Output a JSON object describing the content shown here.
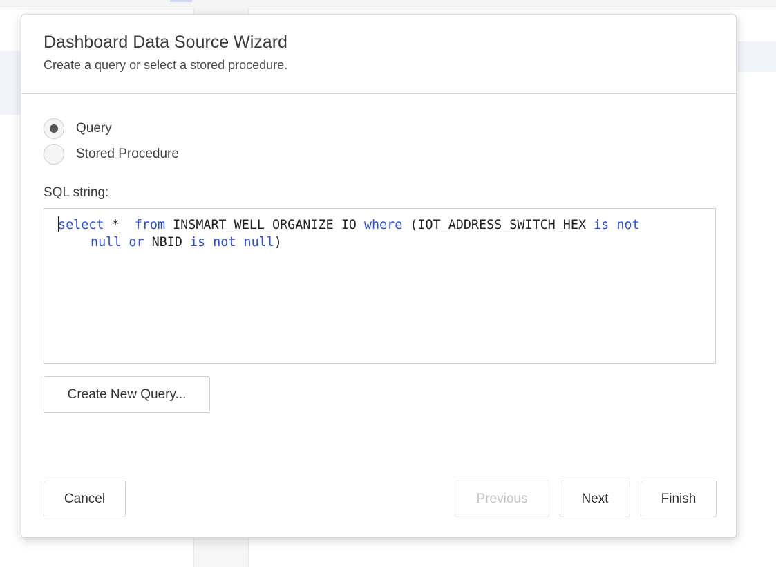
{
  "dialog": {
    "title": "Dashboard Data Source Wizard",
    "subtitle": "Create a query or select a stored procedure."
  },
  "source_type": {
    "options": [
      {
        "label": "Query",
        "checked": true
      },
      {
        "label": "Stored Procedure",
        "checked": false
      }
    ]
  },
  "sql": {
    "label": "SQL string:",
    "line1": {
      "t1": "select",
      "t2": " *  ",
      "t3": "from",
      "t4": " INSMART_WELL_ORGANIZE IO ",
      "t5": "where",
      "t6": " (IOT_ADDRESS_SWITCH_HEX ",
      "t7": "is",
      "t8": " ",
      "t9": "not"
    },
    "line2": {
      "t1": "null",
      "t2": " ",
      "t3": "or",
      "t4": " NBID ",
      "t5": "is",
      "t6": " ",
      "t7": "not",
      "t8": " ",
      "t9": "null",
      "t10": ")"
    }
  },
  "buttons": {
    "create_new_query": "Create New Query...",
    "cancel": "Cancel",
    "previous": "Previous",
    "next": "Next",
    "finish": "Finish"
  },
  "colors": {
    "keyword": "#2b4fe0",
    "disabled_text": "#c4c4c4"
  }
}
